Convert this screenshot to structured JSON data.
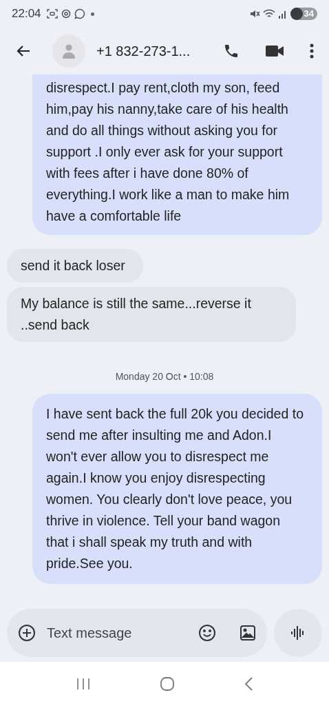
{
  "status_bar": {
    "time": "22:04",
    "battery": "34"
  },
  "header": {
    "contact": "+1 832-273-1..."
  },
  "messages": [
    {
      "kind": "sent",
      "text": "disrespect.I pay rent,cloth my son, feed him,pay his nanny,take care of his health and do all things without asking you for support .I only ever ask for your support with fees after i have done 80% of everything.I work like a man to make him have a comfortable life"
    },
    {
      "kind": "received",
      "text": "send it back loser"
    },
    {
      "kind": "received",
      "text": "My balance is still the same...reverse it ..send back"
    },
    {
      "kind": "timestamp",
      "text": "Monday 20 Oct • 10:08"
    },
    {
      "kind": "sent",
      "text": "I have sent back the full 20k you decided to send me after insulting me and Adon.I won't ever allow you to disrespect me again.I know you enjoy disrespecting women. You clearly don't love peace, you thrive in violence. Tell your band wagon that i shall speak my truth and with pride.See you."
    }
  ],
  "composer": {
    "placeholder": "Text message"
  }
}
